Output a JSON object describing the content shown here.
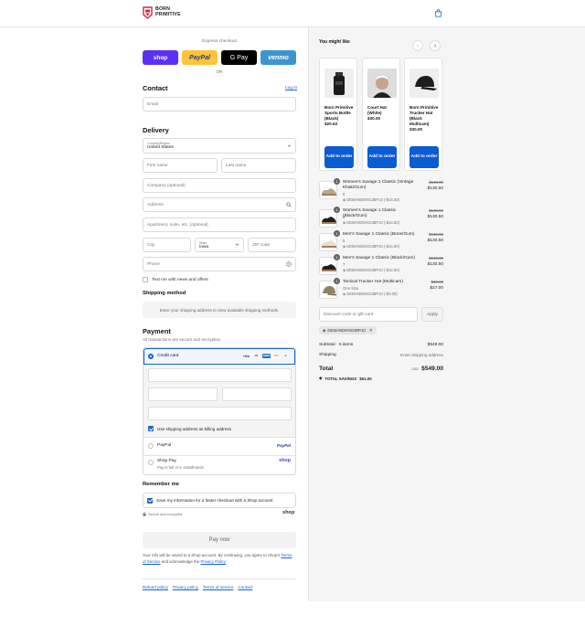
{
  "brand": {
    "line1": "BORN",
    "line2": "PRIMITIVE",
    "accent": "#d3263a"
  },
  "express": {
    "label": "Express checkout",
    "shop": "shop",
    "paypal": "PayPal",
    "gpay": "G Pay",
    "venmo": "venmo",
    "or": "OR"
  },
  "contact": {
    "title": "Contact",
    "login": "Log in",
    "email_placeholder": "Email"
  },
  "delivery": {
    "title": "Delivery",
    "country_label": "Country/Region",
    "country_value": "United States",
    "first_name": "First name",
    "last_name": "Last name",
    "company": "Company (optional)",
    "address": "Address",
    "apartment": "Apartment, suite, etc. (optional)",
    "city": "City",
    "state_label": "State",
    "state_value": "Iowa",
    "zip": "ZIP code",
    "phone": "Phone",
    "text_me": "Text me with news and offers"
  },
  "shipping": {
    "title": "Shipping method",
    "message": "Enter your shipping address to view available shipping methods."
  },
  "payment": {
    "title": "Payment",
    "subtitle": "All transactions are secure and encrypted.",
    "credit_card": "Credit card",
    "cards": [
      "VISA",
      "MC",
      "AMEX",
      "DISC",
      "+5"
    ],
    "billing_same": "Use shipping address as billing address",
    "paypal": "PayPal",
    "paypal_logo": "PayPal",
    "shop_pay": "Shop Pay",
    "shop_pay_sub": "Pay in full or in installments",
    "shop_logo": "shop"
  },
  "remember": {
    "title": "Remember me",
    "save_info": "Save my information for a faster checkout with a Shop account",
    "secure": "Secure and encrypted",
    "shop_logo": "shop"
  },
  "pay_now": "Pay now",
  "legal": {
    "text1": "Your info will be saved to a Shop account. By continuing, you agree to Shop's",
    "terms": "Terms of Service",
    "text2": "and acknowledge the",
    "privacy": "Privacy Policy"
  },
  "footer": {
    "refund": "Refund policy",
    "privacy": "Privacy policy",
    "terms": "Terms of service",
    "contact": "Contact"
  },
  "upsell": {
    "title": "You might like",
    "products": [
      {
        "name": "Born Primitive Sports Bottle (Black)",
        "price": "$20.63",
        "button": "Add to order"
      },
      {
        "name": "Court Hat (White)",
        "price": "$30.00",
        "button": "Add to order"
      },
      {
        "name": "Born Primitive Trucker Hat (Black Multicam)",
        "price": "$30.00",
        "button": "Add to order"
      }
    ]
  },
  "cart": {
    "items": [
      {
        "qty": "1",
        "name": "Women's Savage 1 Classic (Vintage Khaki/Gum)",
        "variant": "5",
        "discount": "DEMANDKNOJBP10 (-$14.50)",
        "original": "$145.00",
        "price": "$130.50"
      },
      {
        "qty": "1",
        "name": "Women's Savage 1 Classic (Black/Gum)",
        "variant": "5",
        "discount": "DEMANDKNOJBP10 (-$14.50)",
        "original": "$145.00",
        "price": "$130.50"
      },
      {
        "qty": "1",
        "name": "Men's Savage 1 Classic (Bone/Gum)",
        "variant": "5",
        "discount": "DEMANDKNOJBP10 (-$14.50)",
        "original": "$145.00",
        "price": "$130.50"
      },
      {
        "qty": "1",
        "name": "Men's Savage 1 Classic (Black/Gum)",
        "variant": "7",
        "discount": "DEMANDKNOJBP10 (-$14.50)",
        "original": "$145.00",
        "price": "$130.50"
      },
      {
        "qty": "1",
        "name": "Tactical Trucker Hat (Multicam)",
        "variant": "One Size",
        "discount": "DEMANDKNOJBP10 (-$3.00)",
        "original": "$30.00",
        "price": "$27.00"
      }
    ],
    "discount_placeholder": "Discount code or gift card",
    "apply": "Apply",
    "applied_code": "DEMANDKNOJBP10",
    "subtotal_label": "Subtotal · 5 items",
    "subtotal_value": "$549.00",
    "shipping_label": "Shipping",
    "shipping_value": "Enter shipping address",
    "total_label": "Total",
    "currency": "USD",
    "total_value": "$549.00",
    "savings_label": "TOTAL SAVINGS",
    "savings_value": "$61.00"
  }
}
